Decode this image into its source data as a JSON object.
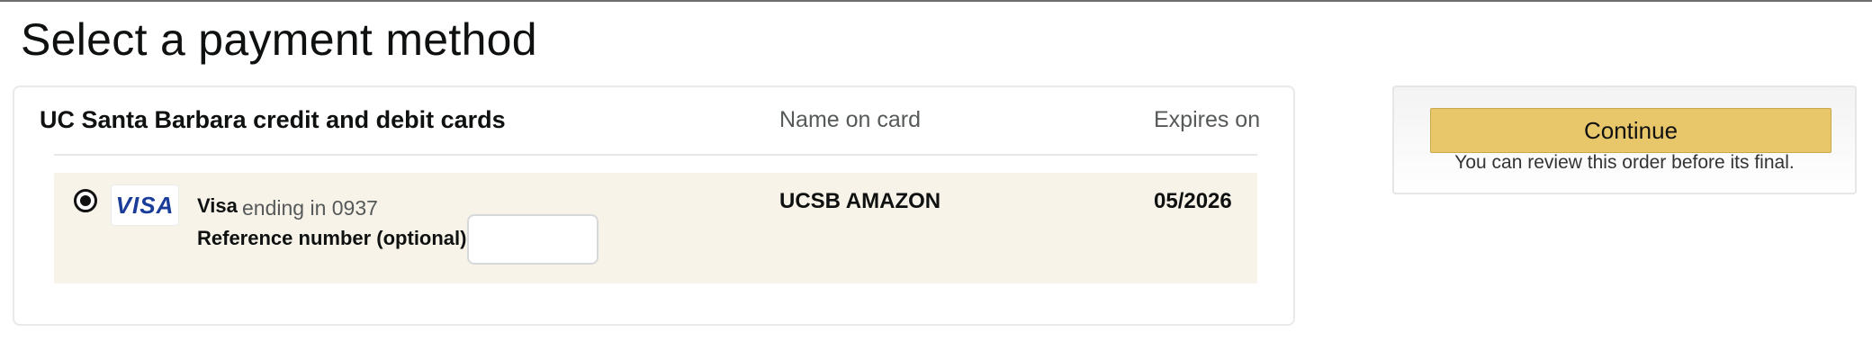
{
  "page": {
    "title": "Select a payment method"
  },
  "cards_section": {
    "header": "UC Santa Barbara credit and debit cards",
    "columns": {
      "name": "Name on card",
      "expires": "Expires on"
    },
    "selected_card": {
      "selected": true,
      "logo_text": "VISA",
      "brand": "Visa",
      "ending": "ending in 0937",
      "reference_label": "Reference number (optional):",
      "reference_value": "",
      "name_on_card": "UCSB AMAZON",
      "expires_on": "05/2026"
    }
  },
  "sidebar": {
    "continue_label": "Continue",
    "note": "You can review this order before its final."
  },
  "colors": {
    "continue_button": "#e7c76a",
    "selected_row": "#f8f3e9",
    "visa_blue": "#1a3d9a"
  },
  "icons": {
    "radio": "radio-selected-icon",
    "card_logo": "visa-logo-icon"
  }
}
